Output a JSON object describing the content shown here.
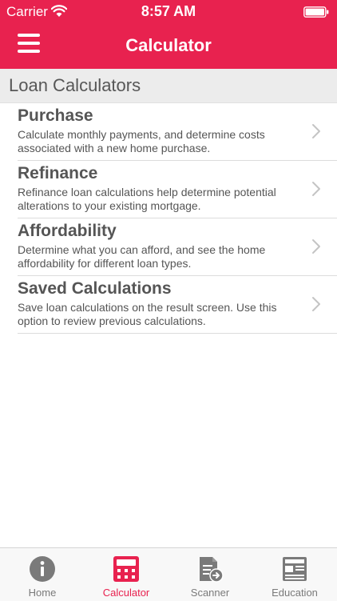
{
  "status_bar": {
    "carrier": "Carrier",
    "time": "8:57 AM"
  },
  "header": {
    "title": "Calculator",
    "menu_icon": "hamburger-menu-icon",
    "background_color": "#e8224f"
  },
  "section": {
    "title": "Loan Calculators"
  },
  "items": [
    {
      "title": "Purchase",
      "description": "Calculate monthly payments, and determine costs associated with a new home purchase."
    },
    {
      "title": "Refinance",
      "description": "Refinance loan calculations help determine potential alterations to your existing mortgage."
    },
    {
      "title": "Affordability",
      "description": "Determine what you can afford, and see the home affordability for different loan types."
    },
    {
      "title": "Saved Calculations",
      "description": "Save loan calculations on the result screen. Use this option to review previous calculations."
    }
  ],
  "tabs": [
    {
      "label": "Home",
      "icon": "info-icon",
      "active": false
    },
    {
      "label": "Calculator",
      "icon": "calculator-icon",
      "active": true
    },
    {
      "label": "Scanner",
      "icon": "scanner-icon",
      "active": false
    },
    {
      "label": "Education",
      "icon": "newspaper-icon",
      "active": false
    }
  ],
  "colors": {
    "accent": "#e8224f",
    "inactive_tab": "#7a7a7a"
  }
}
